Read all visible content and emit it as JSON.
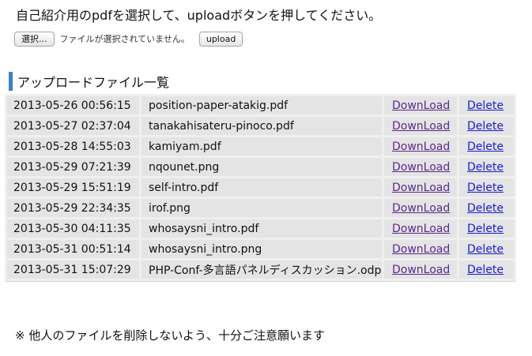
{
  "instruction": "自己紹介用のpdfを選択して、uploadボタンを押してください。",
  "upload": {
    "choose_label": "選択...",
    "no_file_text": "ファイルが選択されていません。",
    "upload_label": "upload"
  },
  "section_title": "アップロードファイル一覧",
  "files": [
    {
      "date": "2013-05-26 00:56:15",
      "name": "position-paper-atakig.pdf",
      "download": "DownLoad",
      "delete": "Delete"
    },
    {
      "date": "2013-05-27 02:37:04",
      "name": "tanakahisateru-pinoco.pdf",
      "download": "DownLoad",
      "delete": "Delete"
    },
    {
      "date": "2013-05-28 14:55:03",
      "name": "kamiyam.pdf",
      "download": "DownLoad",
      "delete": "Delete"
    },
    {
      "date": "2013-05-29 07:21:39",
      "name": "nqounet.png",
      "download": "DownLoad",
      "delete": "Delete"
    },
    {
      "date": "2013-05-29 15:51:19",
      "name": "self-intro.pdf",
      "download": "DownLoad",
      "delete": "Delete"
    },
    {
      "date": "2013-05-29 22:34:35",
      "name": "irof.png",
      "download": "DownLoad",
      "delete": "Delete"
    },
    {
      "date": "2013-05-30 04:11:35",
      "name": "whosaysni_intro.pdf",
      "download": "DownLoad",
      "delete": "Delete"
    },
    {
      "date": "2013-05-31 00:51:14",
      "name": "whosaysni_intro.png",
      "download": "DownLoad",
      "delete": "Delete"
    },
    {
      "date": "2013-05-31 15:07:29",
      "name": "PHP-Conf-多言語パネルディスカッション.odp",
      "download": "DownLoad",
      "delete": "Delete"
    }
  ],
  "note": "※ 他人のファイルを削除しないよう、十分ご注意願います",
  "colors": {
    "visited_link": "#5b2a8c",
    "link": "#1a1ad6",
    "section_accent": "#3f7fc6"
  }
}
